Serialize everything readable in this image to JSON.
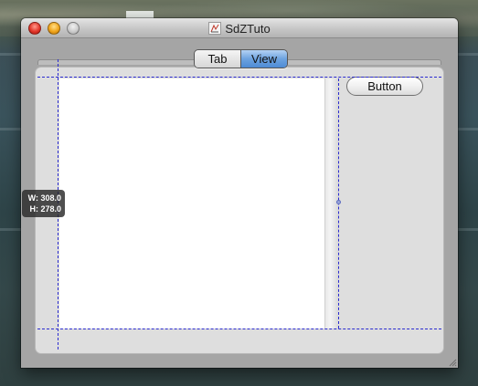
{
  "window": {
    "title": "SdZTuto"
  },
  "segmented_control": {
    "tabs": [
      {
        "label": "Tab",
        "selected": false
      },
      {
        "label": "View",
        "selected": true
      }
    ]
  },
  "content": {
    "button_label": "Button"
  },
  "size_tooltip": {
    "width_text": "W: 308.0",
    "height_text": "H: 278.0"
  },
  "colors": {
    "selected_segment": "#6da3e0",
    "guide_line": "#2b2bd0",
    "close": "#e2362a",
    "minimize": "#f1a51b"
  }
}
